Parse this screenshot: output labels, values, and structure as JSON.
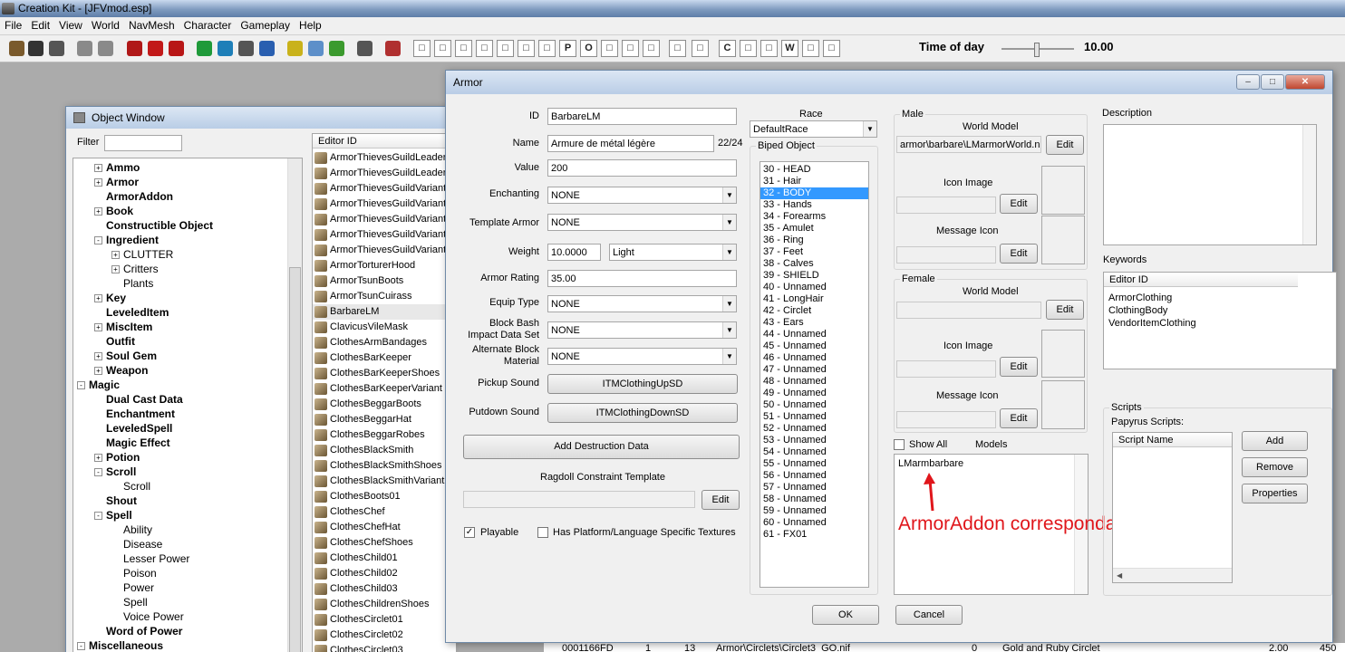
{
  "app": {
    "title": "Creation Kit - [JFVmod.esp]",
    "menu": [
      "File",
      "Edit",
      "View",
      "World",
      "NavMesh",
      "Character",
      "Gameplay",
      "Help"
    ],
    "time_of_day_label": "Time of day",
    "time_of_day_value": "10.00",
    "toolbar_letters": [
      "O",
      "P",
      "C",
      "W"
    ]
  },
  "object_window": {
    "title": "Object Window",
    "filter_label": "Filter",
    "column_editor_id": "Editor ID",
    "tree": [
      {
        "label": "Ammo",
        "level": 1,
        "exp": "+",
        "bold": true
      },
      {
        "label": "Armor",
        "level": 1,
        "exp": "+",
        "bold": true
      },
      {
        "label": "ArmorAddon",
        "level": 1,
        "exp": "",
        "bold": true
      },
      {
        "label": "Book",
        "level": 1,
        "exp": "+",
        "bold": true
      },
      {
        "label": "Constructible Object",
        "level": 1,
        "exp": "",
        "bold": true
      },
      {
        "label": "Ingredient",
        "level": 1,
        "exp": "-",
        "bold": true
      },
      {
        "label": "CLUTTER",
        "level": 2,
        "exp": "+",
        "bold": false
      },
      {
        "label": "Critters",
        "level": 2,
        "exp": "+",
        "bold": false
      },
      {
        "label": "Plants",
        "level": 2,
        "exp": "",
        "bold": false
      },
      {
        "label": "Key",
        "level": 1,
        "exp": "+",
        "bold": true
      },
      {
        "label": "LeveledItem",
        "level": 1,
        "exp": "",
        "bold": true
      },
      {
        "label": "MiscItem",
        "level": 1,
        "exp": "+",
        "bold": true
      },
      {
        "label": "Outfit",
        "level": 1,
        "exp": "",
        "bold": true
      },
      {
        "label": "Soul Gem",
        "level": 1,
        "exp": "+",
        "bold": true
      },
      {
        "label": "Weapon",
        "level": 1,
        "exp": "+",
        "bold": true
      },
      {
        "label": "Magic",
        "level": 0,
        "exp": "-",
        "bold": true
      },
      {
        "label": "Dual Cast Data",
        "level": 1,
        "exp": "",
        "bold": true
      },
      {
        "label": "Enchantment",
        "level": 1,
        "exp": "",
        "bold": true
      },
      {
        "label": "LeveledSpell",
        "level": 1,
        "exp": "",
        "bold": true
      },
      {
        "label": "Magic Effect",
        "level": 1,
        "exp": "",
        "bold": true
      },
      {
        "label": "Potion",
        "level": 1,
        "exp": "+",
        "bold": true
      },
      {
        "label": "Scroll",
        "level": 1,
        "exp": "-",
        "bold": true
      },
      {
        "label": "Scroll",
        "level": 2,
        "exp": "",
        "bold": false
      },
      {
        "label": "Shout",
        "level": 1,
        "exp": "",
        "bold": true
      },
      {
        "label": "Spell",
        "level": 1,
        "exp": "-",
        "bold": true
      },
      {
        "label": "Ability",
        "level": 2,
        "exp": "",
        "bold": false
      },
      {
        "label": "Disease",
        "level": 2,
        "exp": "",
        "bold": false
      },
      {
        "label": "Lesser Power",
        "level": 2,
        "exp": "",
        "bold": false
      },
      {
        "label": "Poison",
        "level": 2,
        "exp": "",
        "bold": false
      },
      {
        "label": "Power",
        "level": 2,
        "exp": "",
        "bold": false
      },
      {
        "label": "Spell",
        "level": 2,
        "exp": "",
        "bold": false
      },
      {
        "label": "Voice Power",
        "level": 2,
        "exp": "",
        "bold": false
      },
      {
        "label": "Word of Power",
        "level": 1,
        "exp": "",
        "bold": true
      },
      {
        "label": "Miscellaneous",
        "level": 0,
        "exp": "-",
        "bold": true
      }
    ],
    "items": [
      "ArmorThievesGuildLeaderC",
      "ArmorThievesGuildLeaderH",
      "ArmorThievesGuildVariantC",
      "ArmorThievesGuildVariantB",
      "ArmorThievesGuildVariantC",
      "ArmorThievesGuildVariantG",
      "ArmorThievesGuildVariantH",
      "ArmorTorturerHood",
      "ArmorTsunBoots",
      "ArmorTsunCuirass",
      "BarbareLM",
      "ClavicusVileMask",
      "ClothesArmBandages",
      "ClothesBarKeeper",
      "ClothesBarKeeperShoes",
      "ClothesBarKeeperVariant",
      "ClothesBeggarBoots",
      "ClothesBeggarHat",
      "ClothesBeggarRobes",
      "ClothesBlackSmith",
      "ClothesBlackSmithShoes",
      "ClothesBlackSmithVariant",
      "ClothesBoots01",
      "ClothesChef",
      "ClothesChefHat",
      "ClothesChefShoes",
      "ClothesChild01",
      "ClothesChild02",
      "ClothesChild03",
      "ClothesChildrenShoes",
      "ClothesCirclet01",
      "ClothesCirclet02",
      "ClothesCirclet03"
    ],
    "bottom_row": {
      "formid": "0001166FD",
      "c1": "1",
      "c2": "13",
      "model": "Armor\\Circlets\\Circlet3_GO.nif",
      "c3": "0",
      "name": "Gold and Ruby Circlet",
      "value": "2.00",
      "c4": "450"
    }
  },
  "armor": {
    "title": "Armor",
    "id_label": "ID",
    "id_value": "BarbareLM",
    "name_label": "Name",
    "name_value": "Armure de métal légère",
    "name_count": "22/24",
    "value_label": "Value",
    "value_value": "200",
    "enchanting_label": "Enchanting",
    "enchanting_value": "NONE",
    "template_label": "Template Armor",
    "template_value": "NONE",
    "weight_label": "Weight",
    "weight_value": "10.0000",
    "weight_class": "Light",
    "rating_label": "Armor Rating",
    "rating_value": "35.00",
    "equip_label": "Equip Type",
    "equip_value": "NONE",
    "block_label": "Block Bash\nImpact Data Set",
    "block_value": "NONE",
    "alt_block_label": "Alternate Block\nMaterial",
    "alt_block_value": "NONE",
    "pickup_label": "Pickup Sound",
    "pickup_value": "ITMClothingUpSD",
    "putdown_label": "Putdown Sound",
    "putdown_value": "ITMClothingDownSD",
    "add_destruction": "Add Destruction Data",
    "ragdoll_label": "Ragdoll Constraint Template",
    "edit": "Edit",
    "playable_label": "Playable",
    "platform_label": "Has Platform/Language Specific Textures",
    "race_label": "Race",
    "race_value": "DefaultRace",
    "biped_label": "Biped Object",
    "biped": [
      "30 - HEAD",
      "31 - Hair",
      "32 - BODY",
      "33 - Hands",
      "34 - Forearms",
      "35 - Amulet",
      "36 - Ring",
      "37 - Feet",
      "38 - Calves",
      "39 - SHIELD",
      "40 - Unnamed",
      "41 - LongHair",
      "42 - Circlet",
      "43 - Ears",
      "44 - Unnamed",
      "45 - Unnamed",
      "46 - Unnamed",
      "47 - Unnamed",
      "48 - Unnamed",
      "49 - Unnamed",
      "50 - Unnamed",
      "51 - Unnamed",
      "52 - Unnamed",
      "53 - Unnamed",
      "54 - Unnamed",
      "55 - Unnamed",
      "56 - Unnamed",
      "57 - Unnamed",
      "58 - Unnamed",
      "59 - Unnamed",
      "60 - Unnamed",
      "61 - FX01"
    ],
    "biped_selected": "32 - BODY",
    "male_label": "Male",
    "female_label": "Female",
    "world_model_label": "World Model",
    "male_world_model": "armor\\barbare\\LMarmorWorld.nif",
    "icon_image_label": "Icon Image",
    "message_icon_label": "Message Icon",
    "show_all_label": "Show All",
    "models_label": "Models",
    "models": [
      "LMarmbarbare"
    ],
    "annotation": "ArmorAddon correspondant",
    "annotation_color": "#e0161b",
    "description_label": "Description",
    "keywords_label": "Keywords",
    "keywords_header": "Editor ID",
    "keywords": [
      "ArmorClothing",
      "ClothingBody",
      "VendorItemClothing"
    ],
    "scripts_label": "Scripts",
    "papyrus_label": "Papyrus Scripts:",
    "script_name_header": "Script Name",
    "add": "Add",
    "remove": "Remove",
    "properties": "Properties",
    "ok": "OK",
    "cancel": "Cancel"
  }
}
